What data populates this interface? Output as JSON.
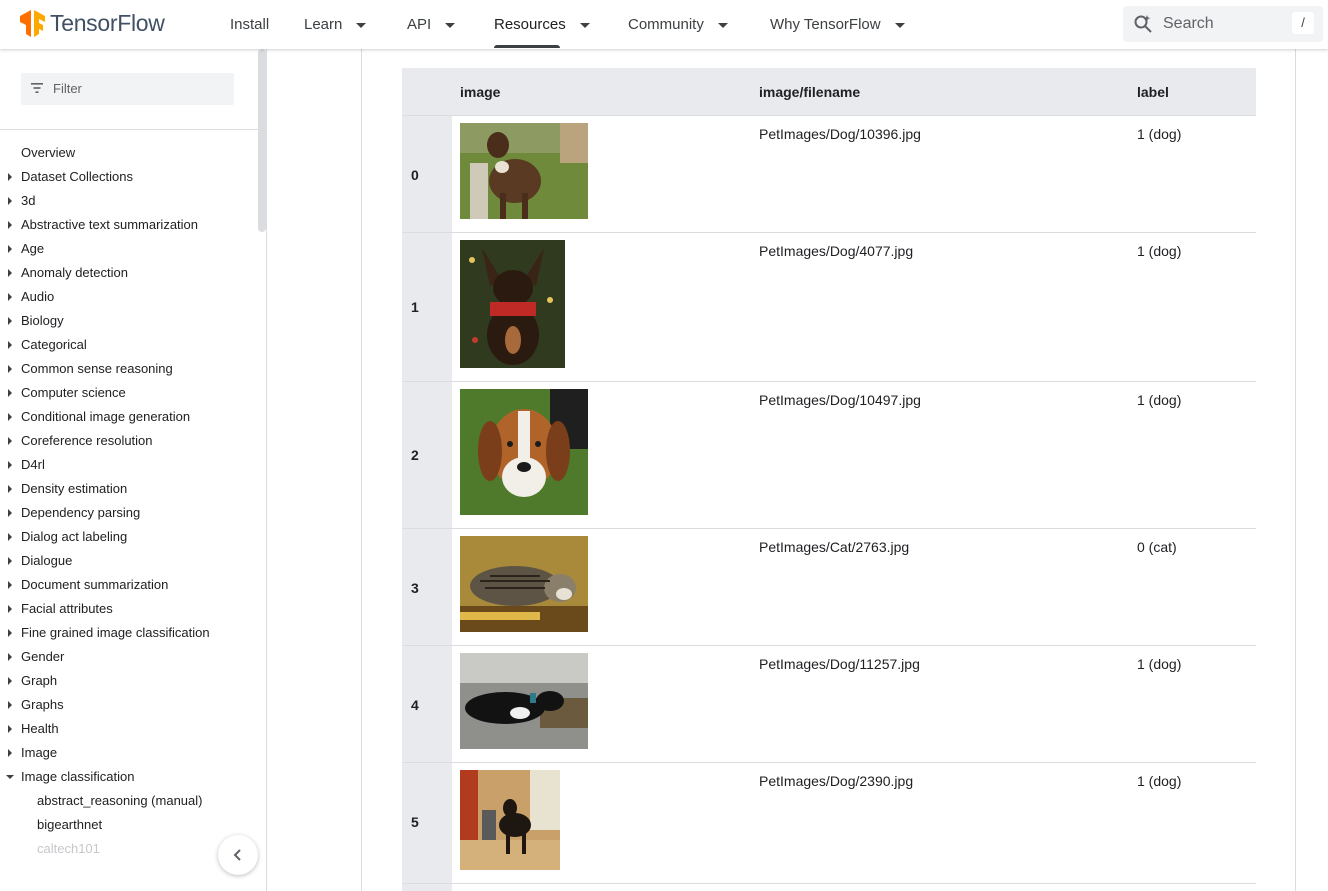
{
  "header": {
    "brand": "TensorFlow",
    "nav": [
      {
        "label": "Install"
      },
      {
        "label": "Learn"
      },
      {
        "label": "API"
      },
      {
        "label": "Resources"
      },
      {
        "label": "Community"
      },
      {
        "label": "Why TensorFlow"
      }
    ],
    "active_nav": "Resources",
    "search_placeholder": "Search",
    "search_shortcut": "/"
  },
  "sidebar": {
    "filter_placeholder": "Filter",
    "items": [
      {
        "label": "Overview"
      },
      {
        "label": "Dataset Collections"
      },
      {
        "label": "3d"
      },
      {
        "label": "Abstractive text summarization"
      },
      {
        "label": "Age"
      },
      {
        "label": "Anomaly detection"
      },
      {
        "label": "Audio"
      },
      {
        "label": "Biology"
      },
      {
        "label": "Categorical"
      },
      {
        "label": "Common sense reasoning"
      },
      {
        "label": "Computer science"
      },
      {
        "label": "Conditional image generation"
      },
      {
        "label": "Coreference resolution"
      },
      {
        "label": "D4rl"
      },
      {
        "label": "Density estimation"
      },
      {
        "label": "Dependency parsing"
      },
      {
        "label": "Dialog act labeling"
      },
      {
        "label": "Dialogue"
      },
      {
        "label": "Document summarization"
      },
      {
        "label": "Facial attributes"
      },
      {
        "label": "Fine grained image classification"
      },
      {
        "label": "Gender"
      },
      {
        "label": "Graph"
      },
      {
        "label": "Graphs"
      },
      {
        "label": "Health"
      },
      {
        "label": "Image"
      },
      {
        "label": "Image classification"
      },
      {
        "label": "abstract_reasoning (manual)"
      },
      {
        "label": "bigearthnet"
      },
      {
        "label": "caltech101"
      }
    ]
  },
  "table": {
    "columns": [
      "image",
      "image/filename",
      "label"
    ],
    "rows": [
      {
        "index": "0",
        "filename": "PetImages/Dog/10396.jpg",
        "label": "1 (dog)",
        "thumb": "brindle-boxer-dog"
      },
      {
        "index": "1",
        "filename": "PetImages/Dog/4077.jpg",
        "label": "1 (dog)",
        "thumb": "chihuahua-red-scarf"
      },
      {
        "index": "2",
        "filename": "PetImages/Dog/10497.jpg",
        "label": "1 (dog)",
        "thumb": "beagle-face"
      },
      {
        "index": "3",
        "filename": "PetImages/Cat/2763.jpg",
        "label": "0 (cat)",
        "thumb": "tabby-cat-lying"
      },
      {
        "index": "4",
        "filename": "PetImages/Dog/11257.jpg",
        "label": "1 (dog)",
        "thumb": "black-dog-on-mat"
      },
      {
        "index": "5",
        "filename": "PetImages/Dog/2390.jpg",
        "label": "1 (dog)",
        "thumb": "dog-in-hallway"
      }
    ]
  },
  "colors": {
    "brand_orange": "#ff6f00",
    "table_header_bg": "#e8eaed",
    "border": "#dadce0"
  }
}
